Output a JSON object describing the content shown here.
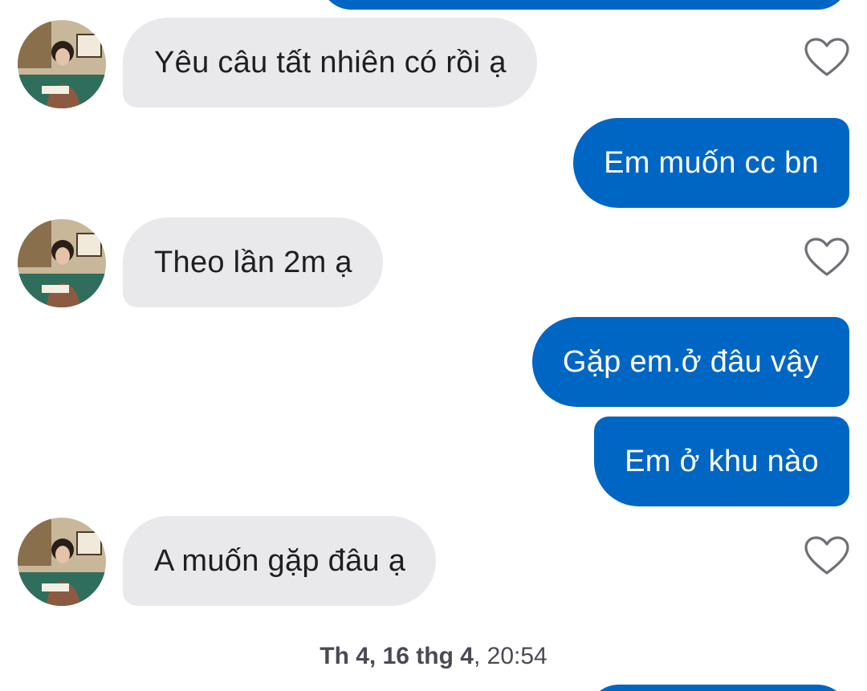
{
  "messages": [
    {
      "direction": "incoming",
      "text": "Yêu câu tất nhiên có rồi ạ"
    },
    {
      "direction": "outgoing",
      "text": "Em muốn cc bn"
    },
    {
      "direction": "incoming",
      "text": "Theo lần 2m ạ"
    },
    {
      "direction": "outgoing",
      "text": "Gặp em.ở đâu vậy"
    },
    {
      "direction": "outgoing",
      "text": "Em ở khu nào"
    },
    {
      "direction": "incoming",
      "text": "A muốn gặp đâu ạ"
    }
  ],
  "timestamp": {
    "day": "Th 4, 16 thg 4",
    "separator": ",",
    "time": " 20:54"
  },
  "icons": {
    "like": "heart-outline-icon",
    "avatar": "contact-avatar"
  },
  "colors": {
    "outgoing_bubble": "#0066c4",
    "incoming_bubble": "#e9e9ec",
    "incoming_text": "#1f1f22",
    "timestamp_text": "#4a4a52",
    "heart_stroke": "#6f6f75"
  }
}
